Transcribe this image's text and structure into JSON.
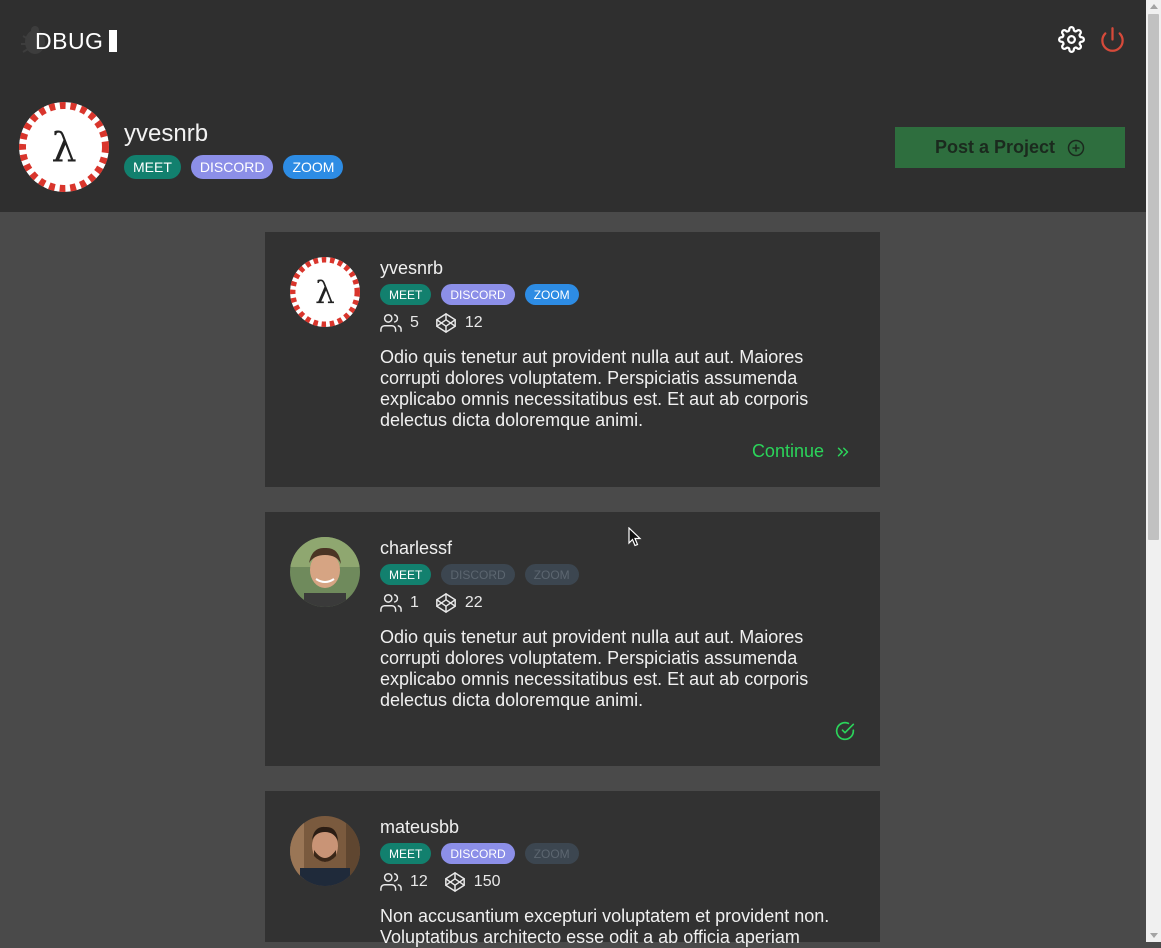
{
  "app": {
    "logo_text": "DBUG"
  },
  "header": {
    "settings_icon": "gear-icon",
    "power_icon": "power-icon",
    "power_color": "#d64a3a"
  },
  "profile": {
    "username": "yvesnrb",
    "tags": [
      "MEET",
      "DISCORD",
      "ZOOM"
    ],
    "post_button_label": "Post a Project",
    "post_button_icon": "plus-circle-icon"
  },
  "colors": {
    "meet": "#12806e",
    "discord": "#8c8fe8",
    "zoom": "#2d8ce4",
    "accent_green": "#2bd45a",
    "post_button_bg": "#2e6e3e"
  },
  "projects": [
    {
      "username": "yvesnrb",
      "avatar": "lambda-logo",
      "tags": [
        {
          "label": "MEET",
          "active": true
        },
        {
          "label": "DISCORD",
          "active": true
        },
        {
          "label": "ZOOM",
          "active": true
        }
      ],
      "members": "5",
      "code": "12",
      "description": "Odio quis tenetur aut provident nulla aut aut. Maiores corrupti dolores voluptatem. Perspiciatis assumenda explicabo omnis necessitatibus est. Et aut ab corporis delectus dicta doloremque animi.",
      "action_label": "Continue",
      "action_icon": "double-chevron-right-icon"
    },
    {
      "username": "charlessf",
      "avatar": "user-photo",
      "tags": [
        {
          "label": "MEET",
          "active": true
        },
        {
          "label": "DISCORD",
          "active": false
        },
        {
          "label": "ZOOM",
          "active": false
        }
      ],
      "members": "1",
      "code": "22",
      "description": "Odio quis tenetur aut provident nulla aut aut. Maiores corrupti dolores voluptatem. Perspiciatis assumenda explicabo omnis necessitatibus est. Et aut ab corporis delectus dicta doloremque animi.",
      "action_icon": "check-circle-icon"
    },
    {
      "username": "mateusbb",
      "avatar": "user-photo",
      "tags": [
        {
          "label": "MEET",
          "active": true
        },
        {
          "label": "DISCORD",
          "active": true
        },
        {
          "label": "ZOOM",
          "active": false
        }
      ],
      "members": "12",
      "code": "150",
      "description": "Non accusantium excepturi voluptatem et provident non. Voluptatibus architecto esse odit a ab officia aperiam"
    }
  ]
}
